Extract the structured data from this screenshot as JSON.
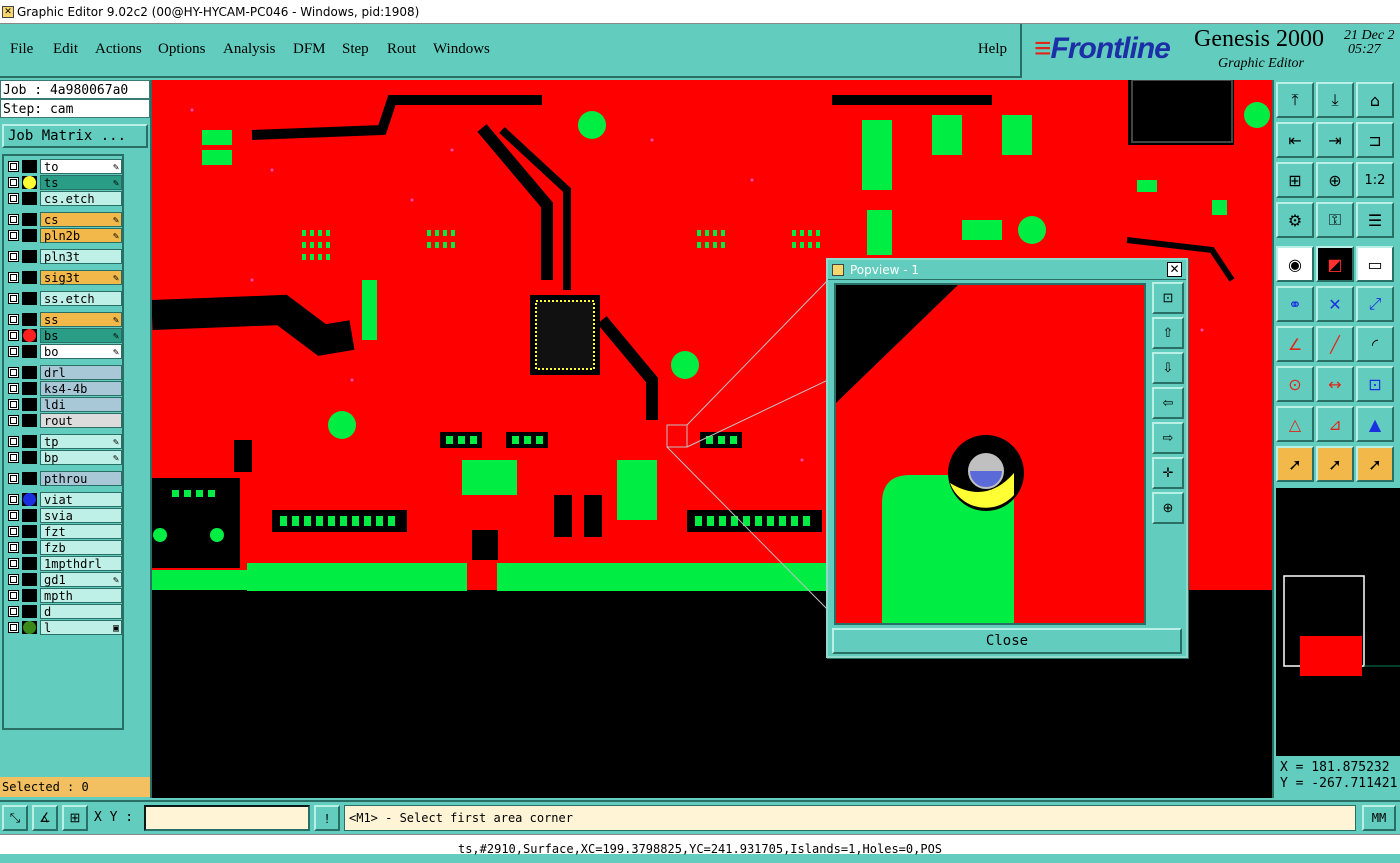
{
  "window": {
    "title": "Graphic Editor 9.02c2 (00@HY-HYCAM-PC046 - Windows, pid:1908)"
  },
  "menu": [
    "File",
    "Edit",
    "Actions",
    "Options",
    "Analysis",
    "DFM",
    "Step",
    "Rout",
    "Windows"
  ],
  "help": "Help",
  "brand": {
    "logo": "Frontline",
    "product": "Genesis 2000",
    "subtitle": "Graphic Editor",
    "date": "21 Dec 2",
    "time": "05:27"
  },
  "job": {
    "job_label": "Job : 4a980067a0",
    "step_label": "Step: cam",
    "matrix_button": "Job Matrix ..."
  },
  "layers": [
    {
      "name": "to",
      "bg": "#ffffff",
      "dot": "",
      "mark": "✎"
    },
    {
      "name": "ts",
      "bg": "#2a9d86",
      "dot": "#ffff33",
      "mark": "✎"
    },
    {
      "name": "cs.etch",
      "bg": "#bff0e8",
      "dot": "",
      "mark": ""
    },
    {
      "name": "cs",
      "bg": "#f2b84a",
      "dot": "",
      "mark": "✎"
    },
    {
      "name": "pln2b",
      "bg": "#f2b84a",
      "dot": "",
      "mark": "✎"
    },
    {
      "name": "pln3t",
      "bg": "#bff0e8",
      "dot": "",
      "mark": ""
    },
    {
      "name": "sig3t",
      "bg": "#f2b84a",
      "dot": "",
      "mark": "✎"
    },
    {
      "name": "ss.etch",
      "bg": "#bff0e8",
      "dot": "",
      "mark": ""
    },
    {
      "name": "ss",
      "bg": "#f2b84a",
      "dot": "",
      "mark": "✎"
    },
    {
      "name": "bs",
      "bg": "#2a9d86",
      "dot": "#ff2020",
      "mark": "✎"
    },
    {
      "name": "bo",
      "bg": "#ffffff",
      "dot": "",
      "mark": "✎"
    },
    {
      "name": "drl",
      "bg": "#a8c8d8",
      "dot": "",
      "mark": ""
    },
    {
      "name": "ks4-4b",
      "bg": "#a8c8d8",
      "dot": "",
      "mark": ""
    },
    {
      "name": "ldi",
      "bg": "#a8c8d8",
      "dot": "",
      "mark": ""
    },
    {
      "name": "rout",
      "bg": "#dcdcdc",
      "dot": "",
      "mark": ""
    },
    {
      "name": "tp",
      "bg": "#bff0e8",
      "dot": "",
      "mark": "✎"
    },
    {
      "name": "bp",
      "bg": "#bff0e8",
      "dot": "",
      "mark": "✎"
    },
    {
      "name": "pthrou",
      "bg": "#a8c8d8",
      "dot": "",
      "mark": ""
    },
    {
      "name": "viat",
      "bg": "#bff0e8",
      "dot": "#1a2fe0",
      "mark": ""
    },
    {
      "name": "svia",
      "bg": "#bff0e8",
      "dot": "",
      "mark": ""
    },
    {
      "name": "fzt",
      "bg": "#bff0e8",
      "dot": "",
      "mark": ""
    },
    {
      "name": "fzb",
      "bg": "#bff0e8",
      "dot": "",
      "mark": ""
    },
    {
      "name": "1mpthdrl",
      "bg": "#bff0e8",
      "dot": "",
      "mark": ""
    },
    {
      "name": "gd1",
      "bg": "#bff0e8",
      "dot": "",
      "mark": "✎"
    },
    {
      "name": "mpth",
      "bg": "#bff0e8",
      "dot": "",
      "mark": ""
    },
    {
      "name": "d",
      "bg": "#bff0e8",
      "dot": "",
      "mark": ""
    },
    {
      "name": "l",
      "bg": "#bff0e8",
      "dot": "#3a8a1a",
      "mark": "▣"
    }
  ],
  "selected": "Selected : 0",
  "popview": {
    "title": "Popview - 1",
    "close_button": "Close"
  },
  "coords": {
    "x": "X = 181.875232",
    "y": "Y = -267.711421"
  },
  "bottom": {
    "xy_label": "X Y :",
    "xy_value": "",
    "prompt": "<M1> - Select first area corner",
    "unit": "MM"
  },
  "status": "ts,#2910,Surface,XC=199.3798825,YC=241.931705,Islands=1,Holes=0,POS",
  "colors": {
    "panel": "#62cdbe",
    "copper": "#ff0000",
    "pad": "#00ee44",
    "highlight": "#ffff33"
  }
}
